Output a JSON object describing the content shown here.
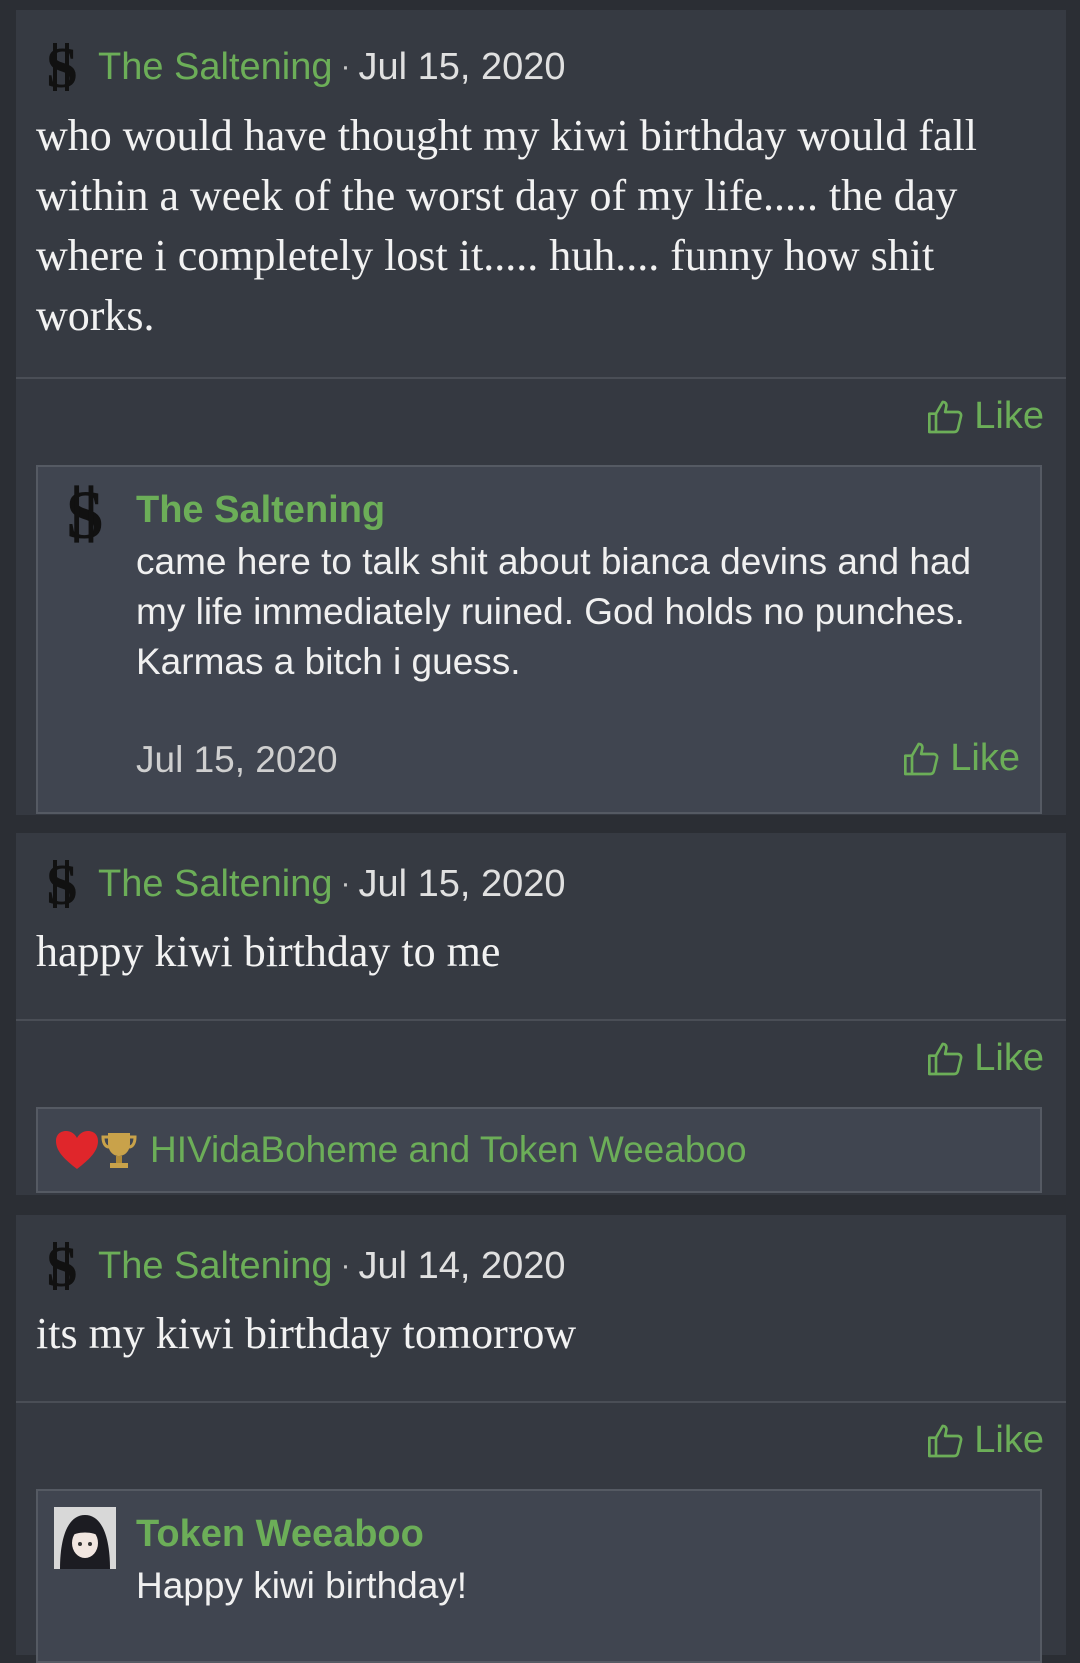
{
  "posts": [
    {
      "author": "The Saltening",
      "separator": "·",
      "date": "Jul 15, 2020",
      "text": "who would have thought my kiwi birthday would fall within a week of the worst day of my life..... the day where i completely lost it..... huh.... funny how shit works.",
      "like_label": "Like",
      "comment": {
        "author": "The Saltening",
        "text": "came here to talk shit about bianca devins and had my life immediately ruined. God holds no punches. Karmas a bitch i guess.",
        "date": "Jul 15, 2020",
        "like_label": "Like"
      }
    },
    {
      "author": "The Saltening",
      "separator": "·",
      "date": "Jul 15, 2020",
      "text": "happy kiwi birthday to me",
      "like_label": "Like",
      "reactions": {
        "icons": [
          "heart-reaction-icon",
          "trophy-reaction-icon"
        ],
        "names": "HIVidaBoheme and Token Weeaboo"
      }
    },
    {
      "author": "The Saltening",
      "separator": "·",
      "date": "Jul 14, 2020",
      "text": "its my kiwi birthday tomorrow",
      "like_label": "Like",
      "comment": {
        "author": "Token Weeaboo",
        "text": "Happy kiwi birthday!"
      }
    }
  ],
  "colors": {
    "accent": "#6cae58",
    "background": "#2b2e34",
    "card": "#363a42",
    "comment": "#404550",
    "heart": "#e0262b"
  }
}
